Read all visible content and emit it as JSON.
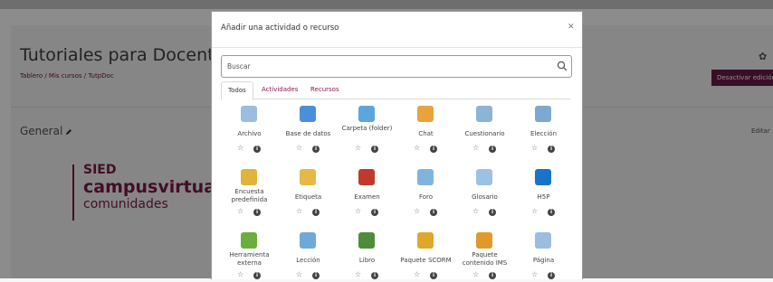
{
  "background": {
    "course_title": "Tutoriales para Docentes",
    "breadcrumb": "Tablero / Mis cursos / TutpDoc",
    "section_title": "General",
    "deactivate_button": "Desactivar edición",
    "edit_link": "Editar",
    "logo": {
      "line1": "SIED",
      "line2": "campusvirtua",
      "line3": "comunidades"
    }
  },
  "modal": {
    "title": "Añadir una actividad o recurso",
    "close_icon": "close-icon",
    "search_placeholder": "Buscar",
    "tabs": [
      {
        "label": "Todos",
        "active": true
      },
      {
        "label": "Actividades",
        "active": false
      },
      {
        "label": "Recursos",
        "active": false
      }
    ],
    "items": [
      {
        "label": "Archivo",
        "icon": "file-icon",
        "color": "#9bbde0"
      },
      {
        "label": "Base de datos",
        "icon": "database-icon",
        "color": "#4a90d9"
      },
      {
        "label": "Carpeta (folder)",
        "icon": "folder-icon",
        "color": "#5aa6df"
      },
      {
        "label": "Chat",
        "icon": "chat-icon",
        "color": "#e8a33c"
      },
      {
        "label": "Cuestionario",
        "icon": "quiz-icon",
        "color": "#8fb3d6"
      },
      {
        "label": "Elección",
        "icon": "question-icon",
        "color": "#7ea8d4"
      },
      {
        "label": "Encuesta predefinida",
        "icon": "survey-icon",
        "color": "#e0b33a"
      },
      {
        "label": "Etiqueta",
        "icon": "tag-icon",
        "color": "#e6b84a"
      },
      {
        "label": "Examen",
        "icon": "checkbox-icon",
        "color": "#c0392b"
      },
      {
        "label": "Foro",
        "icon": "forum-icon",
        "color": "#7fb4e0"
      },
      {
        "label": "Glosario",
        "icon": "glossary-icon",
        "color": "#9cc1e3"
      },
      {
        "label": "H5P",
        "icon": "h5p-icon",
        "color": "#1a73c6"
      },
      {
        "label": "Herramienta externa",
        "icon": "puzzle-icon",
        "color": "#6aaf3d"
      },
      {
        "label": "Lección",
        "icon": "lesson-icon",
        "color": "#6fa9d8"
      },
      {
        "label": "Libro",
        "icon": "book-icon",
        "color": "#4d8d3a"
      },
      {
        "label": "Paquete SCORM",
        "icon": "scorm-icon",
        "color": "#e0a72c"
      },
      {
        "label": "Paquete contenido IMS",
        "icon": "ims-icon",
        "color": "#e09a2c"
      },
      {
        "label": "Página",
        "icon": "page-icon",
        "color": "#9bbde0"
      }
    ],
    "star_glyph": "☆",
    "info_glyph": "i"
  }
}
